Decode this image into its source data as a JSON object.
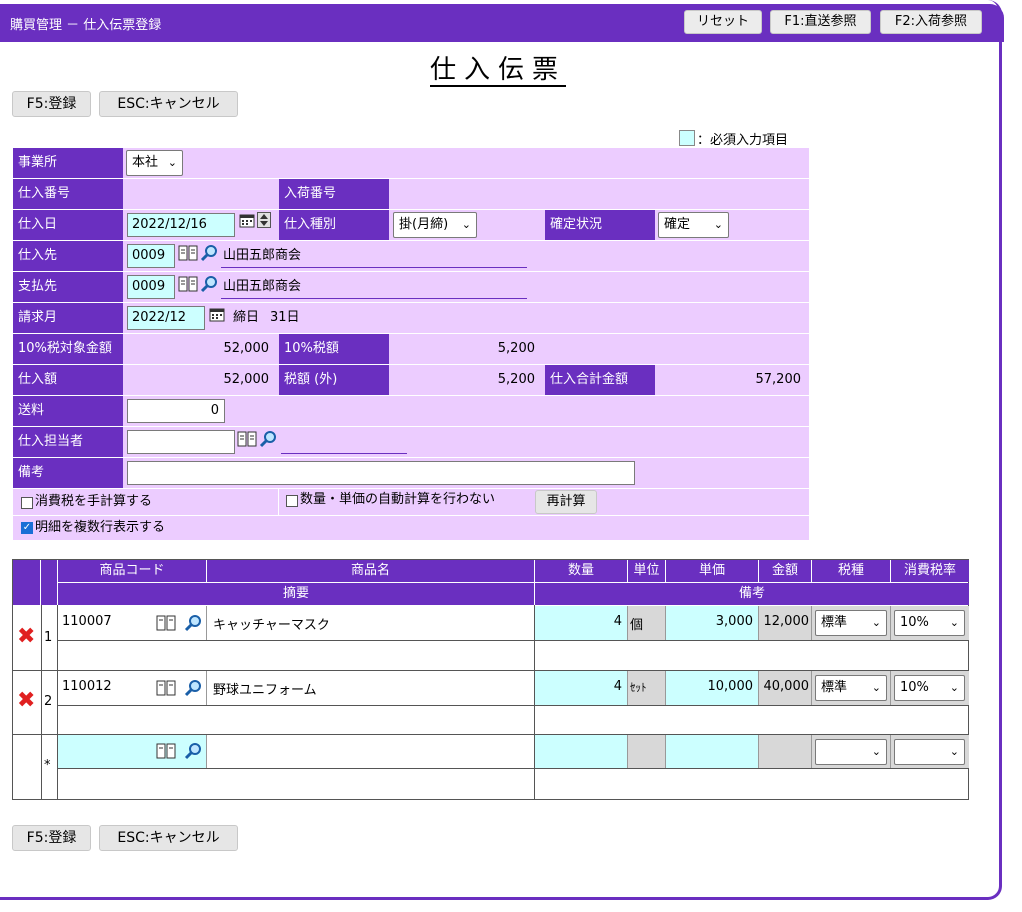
{
  "window": {
    "title": "購買管理 － 仕入伝票登録",
    "buttons": {
      "reset": "リセット",
      "f1": "F1:直送参照",
      "f2": "F2:入荷参照"
    }
  },
  "page": {
    "heading": "仕入伝票",
    "register_label": "F5:登録",
    "cancel_label": "ESC:キャンセル",
    "legend": "：必須入力項目"
  },
  "form": {
    "office": {
      "label": "事業所",
      "value": "本社"
    },
    "purchase_no": {
      "label": "仕入番号",
      "value": ""
    },
    "receipt_no": {
      "label": "入荷番号",
      "value": ""
    },
    "purchase_date": {
      "label": "仕入日",
      "value": "2022/12/16"
    },
    "purchase_type": {
      "label": "仕入種別",
      "value": "掛(月締)"
    },
    "status": {
      "label": "確定状況",
      "value": "確定"
    },
    "supplier": {
      "label": "仕入先",
      "code": "0009",
      "name": "山田五郎商会"
    },
    "payee": {
      "label": "支払先",
      "code": "0009",
      "name": "山田五郎商会"
    },
    "billing_month": {
      "label": "請求月",
      "value": "2022/12",
      "closing_label": "締日",
      "closing_day": "31日"
    },
    "taxable_10": {
      "label": "10%税対象金額",
      "value": "52,000"
    },
    "tax_10": {
      "label": "10%税額",
      "value": "5,200"
    },
    "purchase_amount": {
      "label": "仕入額",
      "value": "52,000"
    },
    "tax_ext": {
      "label": "税額 (外)",
      "value": "5,200"
    },
    "total": {
      "label": "仕入合計金額",
      "value": "57,200"
    },
    "shipping": {
      "label": "送料",
      "value": "0"
    },
    "staff": {
      "label": "仕入担当者",
      "value": ""
    },
    "note": {
      "label": "備考",
      "value": ""
    },
    "manual_tax": {
      "label": "消費税を手計算する",
      "checked": false
    },
    "no_auto_calc": {
      "label": "数量・単価の自動計算を行わない",
      "checked": false
    },
    "recalc_label": "再計算",
    "multiline": {
      "label": "明細を複数行表示する",
      "checked": true
    }
  },
  "grid": {
    "headers": {
      "code": "商品コード",
      "name": "商品名",
      "qty": "数量",
      "unit": "単位",
      "price": "単価",
      "amount": "金額",
      "tax_type": "税種",
      "tax_rate": "消費税率",
      "summary": "摘要",
      "remarks": "備考"
    },
    "rows": [
      {
        "no": "1",
        "code": "110007",
        "name": "キャッチャーマスク",
        "qty": "4",
        "unit": "個",
        "price": "3,000",
        "amount": "12,000",
        "tax_type": "標準",
        "tax_rate": "10%"
      },
      {
        "no": "2",
        "code": "110012",
        "name": "野球ユニフォーム",
        "qty": "4",
        "unit": "ｾｯﾄ",
        "price": "10,000",
        "amount": "40,000",
        "tax_type": "標準",
        "tax_rate": "10%"
      },
      {
        "no": "*",
        "code": "",
        "name": "",
        "qty": "",
        "unit": "",
        "price": "",
        "amount": "",
        "tax_type": "",
        "tax_rate": ""
      }
    ]
  },
  "colors": {
    "accent": "#6a2fc0",
    "form_bg": "#ecccff",
    "required": "#ccffff"
  }
}
